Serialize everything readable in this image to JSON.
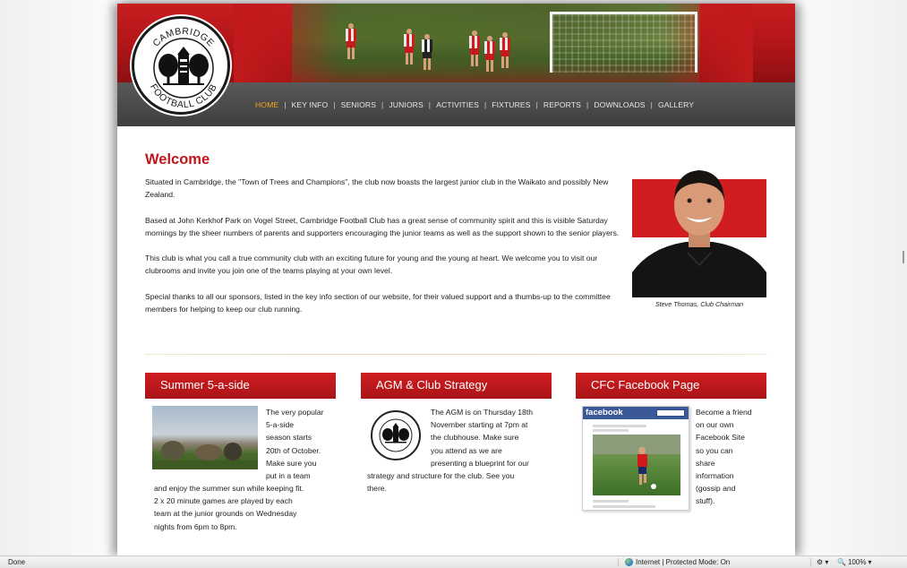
{
  "nav": {
    "items": [
      "HOME",
      "KEY INFO",
      "SENIORS",
      "JUNIORS",
      "ACTIVITIES",
      "FIXTURES",
      "REPORTS",
      "DOWNLOADS",
      "GALLERY"
    ],
    "active": "HOME"
  },
  "logo": {
    "top_text": "CAMBRIDGE",
    "bottom_text": "FOOTBALL CLUB"
  },
  "welcome": {
    "title": "Welcome",
    "paragraphs": [
      "Situated in Cambridge, the \"Town of Trees and Champions\", the club now boasts the largest junior club in the Waikato and possibly New Zealand.",
      "Based at John Kerkhof Park on Vogel Street, Cambridge Football Club has a great sense of community spirit and this is visible Saturday mornings by the sheer numbers of parents and supporters encouraging the junior teams as well as the support shown to the senior players.",
      "This club is what you call a true community club with an exciting future for young and the young at heart. We welcome you to visit our clubrooms and invite you join one of the teams playing at your own level.",
      "Special thanks to all our sponsors, listed in the key info section of our website, for their valued support and a thumbs-up to the committee members for helping to keep our club running."
    ],
    "caption": "Steve Thomas, Club Chairman"
  },
  "boxes": {
    "summer": {
      "title": "Summer 5-a-side",
      "side_lines": [
        "The very popular",
        "5-a-side",
        "season starts",
        "20th of October.",
        "Make sure you",
        "put in a team"
      ],
      "bottom_lines": [
        "and enjoy the summer sun while keeping fit.",
        "2 x 20 minute games are played by each",
        "team at the junior grounds on Wednesday",
        "nights from 6pm to 8pm."
      ]
    },
    "agm": {
      "title": "AGM & Club Strategy",
      "side_lines": [
        "The AGM is on Thursday 18th",
        "November starting at 7pm at",
        "the clubhouse. Make sure",
        "you attend as we are",
        "presenting a blueprint for our"
      ],
      "bottom_lines": [
        "strategy and structure for the club. See you",
        "there."
      ]
    },
    "facebook": {
      "title": "CFC Facebook Page",
      "fb_label": "facebook",
      "side_lines": [
        "Become a friend",
        "on our own",
        "Facebook Site",
        "so you can",
        "share",
        "information",
        "(gossip and",
        "stuff)."
      ]
    }
  },
  "statusbar": {
    "left": "Done",
    "zone": "Internet | Protected Mode: On",
    "zoom": "100%"
  },
  "colors": {
    "brand_red": "#c0161a",
    "nav_active": "#f6a21c",
    "nav_bg": "#474747"
  }
}
